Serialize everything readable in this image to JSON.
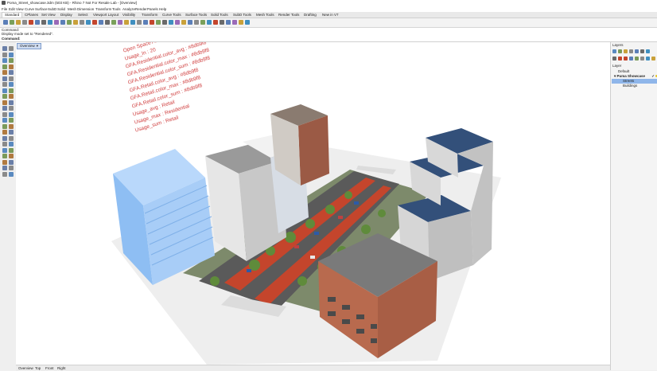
{
  "window": {
    "title": "Poma_Street_showcase.3dm (503 KB) - Rhino 7 Not For Resale Lab - [Overview]"
  },
  "menu": [
    "File",
    "Edit",
    "View",
    "Curve",
    "Surface",
    "SubD",
    "Solid",
    "Mesh",
    "Dimension",
    "Transform",
    "Tools",
    "Analyze",
    "Render",
    "Panels",
    "Help"
  ],
  "tabs": [
    "Standard",
    "CPlanes",
    "Set View",
    "Display",
    "Select",
    "Viewport Layout",
    "Visibility",
    "Transform",
    "Curve Tools",
    "Surface Tools",
    "Solid Tools",
    "SubD Tools",
    "Mesh Tools",
    "Render Tools",
    "Drafting",
    "New in V7"
  ],
  "command_history": [
    "Command:",
    "Display mode set to \"Rendered\"."
  ],
  "command_prompt": "Command:",
  "viewport": {
    "tab_label": "Overview"
  },
  "bottom_tabs": [
    "Overview",
    "Top",
    "Front",
    "Right"
  ],
  "layers_panel": {
    "header": "Layers",
    "column": "Layer",
    "layers": [
      {
        "name": "Default",
        "indent": 0,
        "selected": false
      },
      {
        "name": "Puma Showcase",
        "indent": 0,
        "selected": false,
        "checked": true
      },
      {
        "name": "Streets",
        "indent": 1,
        "selected": true
      },
      {
        "name": "Buildings",
        "indent": 1,
        "selected": false
      }
    ]
  },
  "annotations": [
    "Open Space Area: 7367.63",
    "Usage_In : 20",
    "GFA.Residential.color_avg : #8db9f8",
    "GFA.Residential.color_max : #8db9f8",
    "GFA.Residential.color_sum : #8db9f8",
    "GFA.Retail.color_avg : #8db9f8",
    "GFA.Retail.color_max : #8db9f8",
    "GFA.Retail.color_sum : #8db9f8",
    "Usage_avg : Retail",
    "Usage_max : Residential",
    "Usage_sum : Retail"
  ],
  "colors": {
    "accent_selection": "#8fb6ea",
    "bike_lane": "#c4452c",
    "annotation_text": "#d04040",
    "highlight_building": "#9cc6f5"
  }
}
